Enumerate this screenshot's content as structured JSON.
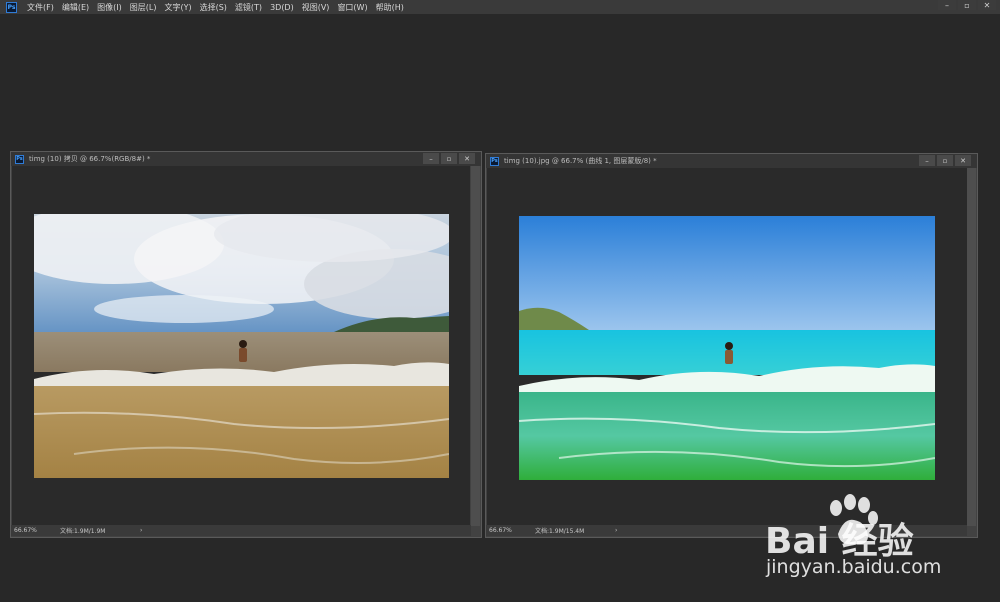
{
  "app": {
    "logo_text": "Ps"
  },
  "menu": [
    "文件(F)",
    "编辑(E)",
    "图像(I)",
    "图层(L)",
    "文字(Y)",
    "选择(S)",
    "滤镜(T)",
    "3D(D)",
    "视图(V)",
    "窗口(W)",
    "帮助(H)"
  ],
  "window_controls": {
    "minimize": "–",
    "restore": "▫",
    "close": "✕"
  },
  "documents": [
    {
      "title": "timg (10) 拷贝 @ 66.7%(RGB/8#) *",
      "zoom": "66.67%",
      "doc_size": "文档:1.9M/1.9M",
      "arrow": "›"
    },
    {
      "title": "timg (10).jpg @ 66.7% (曲线 1, 图层蒙版/8) *",
      "zoom": "66.67%",
      "doc_size": "文档:1.9M/15.4M",
      "arrow": "›"
    }
  ],
  "watermark": {
    "brand": "Bai 经验",
    "url": "jingyan.baidu.com",
    "icon": "paw-icon"
  },
  "colors": {
    "workspace": "#282828",
    "menubar": "#3a3a3a",
    "accent": "#2f7bd6"
  }
}
